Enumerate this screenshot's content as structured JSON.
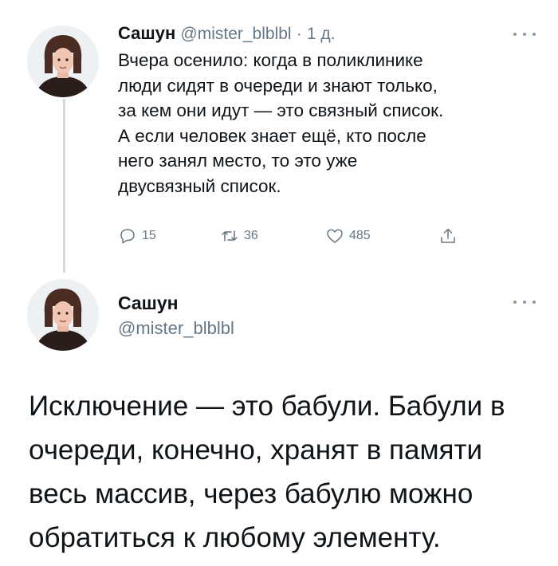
{
  "tweet1": {
    "name": "Сашун",
    "handle": "@mister_blblbl",
    "separator": "·",
    "time": "1 д.",
    "lines": [
      "Вчера осенило: когда в поликлинике",
      "люди сидят в очереди и знают только,",
      "за кем они идут — это связный список.",
      "А если человек знает ещё, кто после",
      "него занял место, то это уже",
      "двусвязный список."
    ],
    "actions": {
      "replies": "15",
      "retweets": "36",
      "likes": "485",
      "reply_icon": "reply-icon",
      "retweet_icon": "retweet-icon",
      "like_icon": "heart-icon",
      "share_icon": "share-icon"
    }
  },
  "tweet2": {
    "name": "Сашун",
    "handle": "@mister_blblbl",
    "lines": [
      "Исключение — это бабули. Бабули в",
      "очереди, конечно, хранят в памяти",
      "весь массив, через бабулю можно",
      "обратиться к любому элементу."
    ]
  },
  "colors": {
    "text": "#0f1419",
    "secondary": "#657786",
    "thread_line": "#cfd9de"
  }
}
